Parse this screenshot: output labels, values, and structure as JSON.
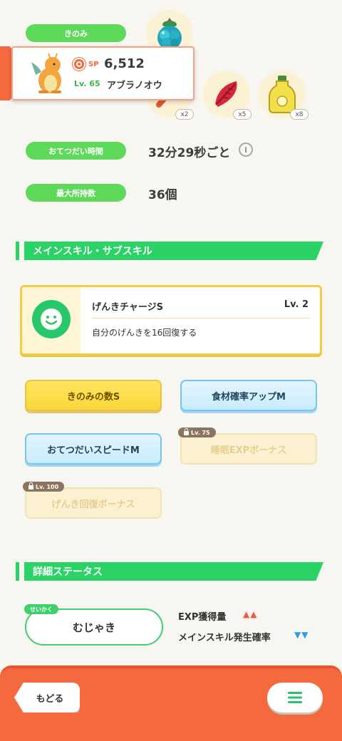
{
  "berry": {
    "label": "きのみ"
  },
  "pokemon": {
    "sp_label": "SP",
    "strength": "6,512",
    "level": "Lv. 65",
    "name": "アブラノオウ"
  },
  "ingredients": [
    {
      "name": "berry-ingredient",
      "count": ""
    },
    {
      "name": "leek",
      "count": "x2"
    },
    {
      "name": "tomato",
      "count": "x5"
    },
    {
      "name": "oil",
      "count": "x8"
    }
  ],
  "help_time": {
    "label": "おてつだい時間",
    "value": "32分29秒ごと",
    "info": "i"
  },
  "max_carry": {
    "label": "最大所持数",
    "value": "36個"
  },
  "skills_section": {
    "title": "メインスキル・サブスキル"
  },
  "main_skill": {
    "name": "げんきチャージS",
    "level": "Lv. 2",
    "description": "自分のげんきを16回復する"
  },
  "sub_skills": [
    {
      "label": "きのみの数S",
      "style": "yellow",
      "lock": ""
    },
    {
      "label": "食材確率アップM",
      "style": "blue",
      "lock": ""
    },
    {
      "label": "おてつだいスピードM",
      "style": "blue",
      "lock": ""
    },
    {
      "label": "睡眠EXPボーナス",
      "style": "locked",
      "lock": "Lv. 75"
    },
    {
      "label": "げんき回復ボーナス",
      "style": "locked",
      "lock": "Lv. 100"
    }
  ],
  "details_section": {
    "title": "詳細ステータス"
  },
  "nature": {
    "tag": "せいかく",
    "value": "むじゃき",
    "up_stat": "EXP獲得量",
    "up_marks": "▲▲",
    "down_stat": "メインスキル発生確率",
    "down_marks": "▼▼"
  },
  "footer": {
    "back_label": "もどる"
  },
  "colors": {
    "green": "#5fd95a",
    "section_green": "#2bd367",
    "accent_orange": "#f4693e",
    "up_red": "#f05a3c",
    "down_blue": "#2f9ee0"
  }
}
